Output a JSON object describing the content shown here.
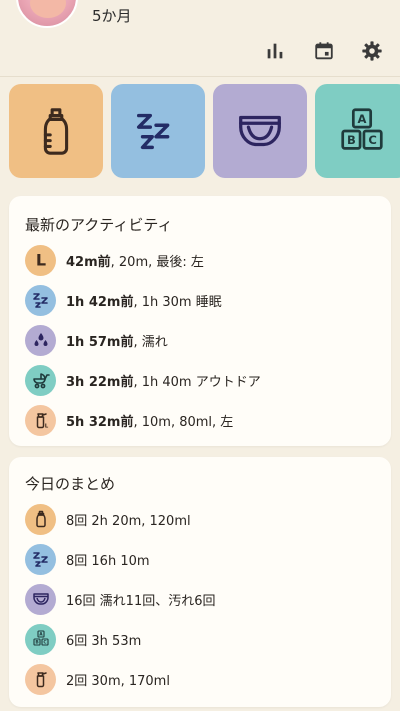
{
  "profile": {
    "age": "5か月"
  },
  "header_icons": [
    "bar-chart-icon",
    "calendar-icon",
    "gear-icon"
  ],
  "colors": {
    "background": "#f5efe2",
    "feeding": "#f0bf84",
    "sleep": "#94bfe0",
    "diaper": "#b3abd2",
    "play": "#7fcdc3",
    "pumping": "#f4c6a0",
    "icon_ink": "#3a2f6e"
  },
  "quick_actions": [
    {
      "name": "feeding",
      "icon": "bottle-icon"
    },
    {
      "name": "sleep",
      "icon": "zzz-icon"
    },
    {
      "name": "diaper",
      "icon": "diaper-icon"
    },
    {
      "name": "play",
      "icon": "abc-blocks-icon"
    }
  ],
  "recent": {
    "title": "最新のアクティビティ",
    "items": [
      {
        "type": "feeding",
        "icon": "letter-l-icon",
        "time": "42m前",
        "detail": ", 20m, 最後: 左"
      },
      {
        "type": "sleep",
        "icon": "zzz-icon",
        "time": "1h 42m前",
        "detail": ", 1h 30m 睡眠"
      },
      {
        "type": "diaper",
        "icon": "droplets-icon",
        "time": "1h 57m前",
        "detail": ", 濡れ"
      },
      {
        "type": "outdoor",
        "icon": "stroller-icon",
        "time": "3h 22m前",
        "detail": ", 1h 40m アウトドア"
      },
      {
        "type": "pumping",
        "icon": "pump-bottle-icon",
        "time": "5h 32m前",
        "detail": ", 10m, 80ml, 左"
      }
    ]
  },
  "summary": {
    "title": "今日のまとめ",
    "items": [
      {
        "type": "feeding",
        "icon": "bottle-icon",
        "text": "8回 2h 20m, 120ml"
      },
      {
        "type": "sleep",
        "icon": "zzz-icon",
        "text": "8回 16h 10m"
      },
      {
        "type": "diaper",
        "icon": "diaper-icon",
        "text": "16回 濡れ11回、汚れ6回"
      },
      {
        "type": "play",
        "icon": "abc-blocks-icon",
        "text": "6回 3h 53m"
      },
      {
        "type": "pumping",
        "icon": "pump-bottle-icon",
        "text": "2回 30m, 170ml"
      }
    ]
  }
}
